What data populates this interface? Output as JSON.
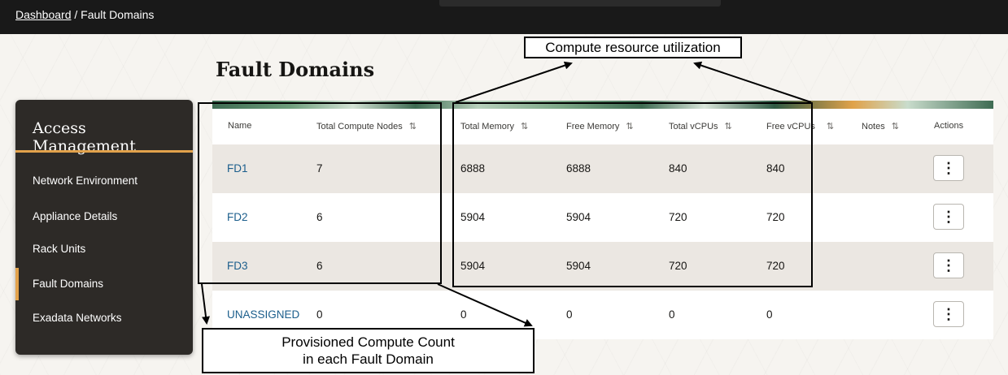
{
  "breadcrumb": {
    "dashboard_link": "Dashboard",
    "separator": " / ",
    "current": "Fault Domains"
  },
  "page": {
    "title": "Fault Domains"
  },
  "sidebar": {
    "header": "Access Management",
    "active_item": "Fault Domains",
    "items": [
      {
        "label": "Network Environment"
      },
      {
        "label": "Appliance Details"
      },
      {
        "label": "Rack Units"
      },
      {
        "label": "Fault Domains"
      },
      {
        "label": "Exadata Networks"
      }
    ]
  },
  "table": {
    "columns": [
      {
        "label": "Name",
        "sortable": false
      },
      {
        "label": "Total Compute Nodes",
        "sortable": true
      },
      {
        "label": "Total Memory",
        "sortable": true
      },
      {
        "label": "Free Memory",
        "sortable": true
      },
      {
        "label": "Total vCPUs",
        "sortable": true
      },
      {
        "label": "Free vCPUs",
        "sortable": true
      },
      {
        "label": "Notes",
        "sortable": true
      },
      {
        "label": "Actions",
        "sortable": false
      }
    ],
    "sort_icon": "⇅",
    "rows": [
      {
        "name": "FD1",
        "total_compute_nodes": "7",
        "total_memory": "6888",
        "free_memory": "6888",
        "total_vcpus": "840",
        "free_vcpus": "840",
        "notes": ""
      },
      {
        "name": "FD2",
        "total_compute_nodes": "6",
        "total_memory": "5904",
        "free_memory": "5904",
        "total_vcpus": "720",
        "free_vcpus": "720",
        "notes": ""
      },
      {
        "name": "FD3",
        "total_compute_nodes": "6",
        "total_memory": "5904",
        "free_memory": "5904",
        "total_vcpus": "720",
        "free_vcpus": "720",
        "notes": ""
      },
      {
        "name": "UNASSIGNED",
        "total_compute_nodes": "0",
        "total_memory": "0",
        "free_memory": "0",
        "total_vcpus": "0",
        "free_vcpus": "0",
        "notes": ""
      }
    ],
    "actions_icon": "⋮"
  },
  "annotations": {
    "utilization_label": "Compute resource utilization",
    "provisioned_label_line1": "Provisioned Compute Count",
    "provisioned_label_line2": "in each Fault Domain"
  },
  "colors": {
    "topbar": "#191919",
    "sidebar": "#2d2a27",
    "accent": "#e2a24b",
    "link": "#1b5e8c",
    "row_shade": "#ebe7e2"
  }
}
